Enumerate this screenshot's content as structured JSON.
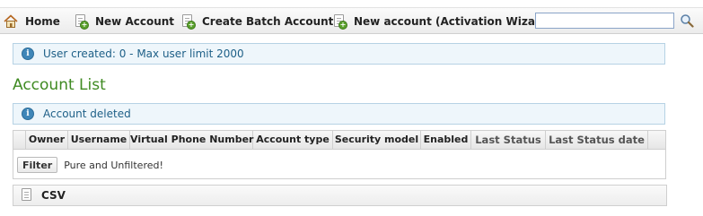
{
  "toolbar": {
    "items": [
      {
        "label": "Home",
        "icon": "home-icon"
      },
      {
        "label": "New Account",
        "icon": "new-document-icon"
      },
      {
        "label": "Create Batch Account",
        "icon": "new-document-icon"
      },
      {
        "label": "New account (Activation Wizard)",
        "icon": "new-document-icon"
      }
    ],
    "search": {
      "value": "",
      "placeholder": "",
      "button_icon": "search-icon"
    }
  },
  "messages": {
    "user_created": "User created: 0 - Max user limit 2000",
    "account_deleted": "Account deleted"
  },
  "main": {
    "title": "Account List",
    "table": {
      "columns": [
        "Owner",
        "Username",
        "Virtual Phone Number",
        "Account type",
        "Security model",
        "Enabled",
        "Last Status",
        "Last Status date"
      ],
      "filter_button": "Filter",
      "filter_text": "Pure and Unfiltered!"
    },
    "csv_label": "CSV"
  },
  "colors": {
    "title_green": "#3f8a22",
    "info_bg": "#eef6fb",
    "info_text": "#1d5f87",
    "info_border": "#b6d2e4"
  }
}
